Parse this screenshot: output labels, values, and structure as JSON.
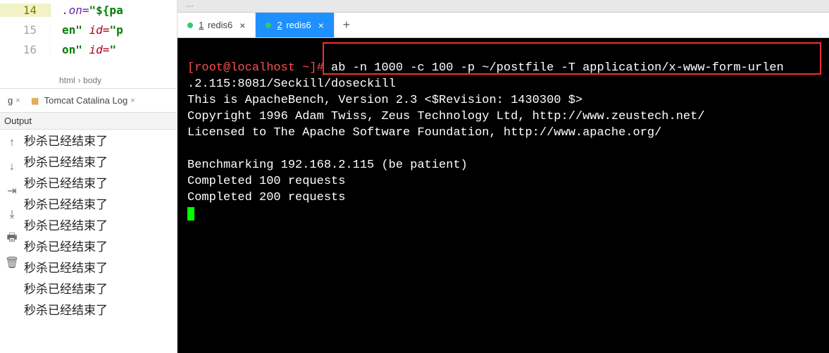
{
  "code": {
    "lines": [
      {
        "num": "14",
        "hl": true,
        "frag1": ".on=",
        "frag2": "\"${pa"
      },
      {
        "num": "15",
        "hl": false,
        "frag1": "en\"",
        "frag2": " id=",
        "frag3": "\"p"
      },
      {
        "num": "16",
        "hl": false,
        "frag1": "on\"",
        "frag2": " id=",
        "frag3": "\""
      }
    ],
    "breadcrumb": [
      "html",
      "body"
    ]
  },
  "bottom_tabs": {
    "tab_a": "g",
    "tab_b": "Tomcat Catalina Log"
  },
  "output": {
    "header": "Output",
    "lines": [
      "秒杀已经结束了",
      "秒杀已经结束了",
      "秒杀已经结束了",
      "秒杀已经结束了",
      "秒杀已经结束了",
      "秒杀已经结束了",
      "秒杀已经结束了",
      "秒杀已经结束了",
      "秒杀已经结束了"
    ]
  },
  "term_tabs": [
    {
      "num": "1",
      "label": "redis6",
      "active": false
    },
    {
      "num": "2",
      "label": "redis6",
      "active": true
    }
  ],
  "terminal": {
    "prompt": "[root@localhost ~]# ",
    "cmd1": "ab -n 1000 -c 100 -p ~/postfile -T application/x-www-form-urlen",
    "cmd2": ".2.115:8081/Seckill/doseckill",
    "line3": "This is ApacheBench, Version 2.3 <$Revision: 1430300 $>",
    "line4": "Copyright 1996 Adam Twiss, Zeus Technology Ltd, http://www.zeustech.net/",
    "line5": "Licensed to The Apache Software Foundation, http://www.apache.org/",
    "blank": "",
    "line6": "Benchmarking 192.168.2.115 (be patient)",
    "line7": "Completed 100 requests",
    "line8": "Completed 200 requests"
  },
  "toolbar_hint": "soft-wrap"
}
